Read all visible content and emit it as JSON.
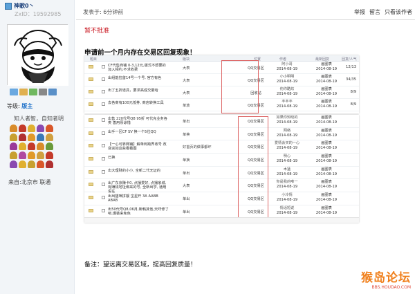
{
  "user": {
    "name": "神歌0丶",
    "zxid": "ZxID：19592985",
    "level_label": "等级:",
    "level_value": "版主",
    "motto": "知人者智，自知者明",
    "from": "来自:北京市 联通"
  },
  "post": {
    "meta": "发表于: 6分钟前",
    "actions": [
      "举报",
      "留言",
      "只看该作者"
    ],
    "notice": "暂不批准",
    "headline": "申请前一个月内存在交易区回复现象！",
    "note": "备注：望远离交易区域，提高回复质量！"
  },
  "table_headers": [
    "题目",
    "版块",
    "帖数",
    "位置",
    "作者",
    "最新回复",
    "回复/人气"
  ],
  "table1": [
    {
      "title": "CF代售商铺 0-3,12元,版式不想要的加入相约,不求收费",
      "forum": "大表",
      "zone": "QQ交易区",
      "author": "阿小哥",
      "adate": "2014-08-19",
      "reply": "画图表",
      "rdate": "2014-08-19",
      "count": "12/13"
    },
    {
      "title": "出组能拉首14号一个号, 官方有色",
      "forum": "大表",
      "zone": "QQ交易区",
      "author": "小小明明",
      "adate": "2014-08-19",
      "reply": "画图表",
      "rdate": "2014-08-19",
      "count": "34/35"
    },
    {
      "title": "出了五折道具，要求高成交量哈",
      "forum": "大表",
      "zone": "回收站",
      "author": "伤你酷炫",
      "adate": "2014-08-19",
      "reply": "画图表",
      "rdate": "2014-08-19",
      "count": "8/9"
    },
    {
      "title": "去各商有100元抵券, 商店转换工具",
      "forum": "单放",
      "zone": "QQ交易区",
      "author": "丰丰丰",
      "adate": "2014-08-19",
      "reply": "画图表",
      "rdate": "2014-08-19",
      "count": "8/9"
    }
  ],
  "table2": [
    {
      "title": "出售 220代号Q8 95折 可代充业务各类 善用原谅惜",
      "forum": "单出",
      "zone": "QQ交易区",
      "author": "如果你知晓的",
      "adate": "2014-08-19",
      "reply": "画图表",
      "rdate": "2014-08-19",
      "count": ""
    },
    {
      "title": "出手一区CF SV 换一个5位QQ",
      "forum": "单换",
      "zone": "QQ交易区",
      "author": "网络",
      "adate": "2014-08-19",
      "reply": "画图表",
      "rdate": "2014-08-19",
      "count": ""
    },
    {
      "title": "【一心可靠网铺】解单到跨界收号 改变完如这些看看图",
      "forum": "好首页的做事都坏",
      "zone": "QQ交易区",
      "author": "爱情会买的一心",
      "adate": "2014-08-19",
      "reply": "画图表",
      "rdate": "2014-08-19",
      "count": ""
    },
    {
      "title": "已换",
      "forum": "单换",
      "zone": "QQ交易区",
      "author": "明心",
      "adate": "2014-08-19",
      "reply": "画图表",
      "rdate": "2014-08-19",
      "count": ""
    },
    {
      "title": "出大理财的小小, 全新二代无证的",
      "forum": "单出",
      "zone": "QQ交易区",
      "author": "木猛",
      "adate": "2014-08-19",
      "reply": "画图表",
      "rdate": "2014-08-19",
      "count": ""
    },
    {
      "title": "出广东京赚卡0, 点播爱好, 点播家城, 有赚钱地址绑来的号, 全新出学, 通用说在",
      "forum": "大表",
      "zone": "QQ交易区",
      "author": "你是我的唯一",
      "adate": "2014-08-19",
      "reply": "画图表",
      "rdate": "2014-08-19",
      "count": ""
    },
    {
      "title": "出出猫咪拼靓 宝星开 3A AABB ABAB",
      "forum": "单出",
      "zone": "QQ交易区",
      "author": "小冷情",
      "adate": "2014-08-19",
      "reply": "画图表",
      "rdate": "2014-08-19",
      "count": ""
    },
    {
      "title": "出50代号Q8,06月,新韩其他,天咩修了吧,爆装来免色",
      "forum": "单出",
      "zone": "QQ交易区",
      "author": "情话短说",
      "adate": "2014-08-19",
      "reply": "画图表",
      "rdate": "2014-08-19",
      "count": ""
    }
  ],
  "watermark": {
    "logo": "猴岛论坛",
    "url": "BBS.HOUDAO.COM"
  }
}
